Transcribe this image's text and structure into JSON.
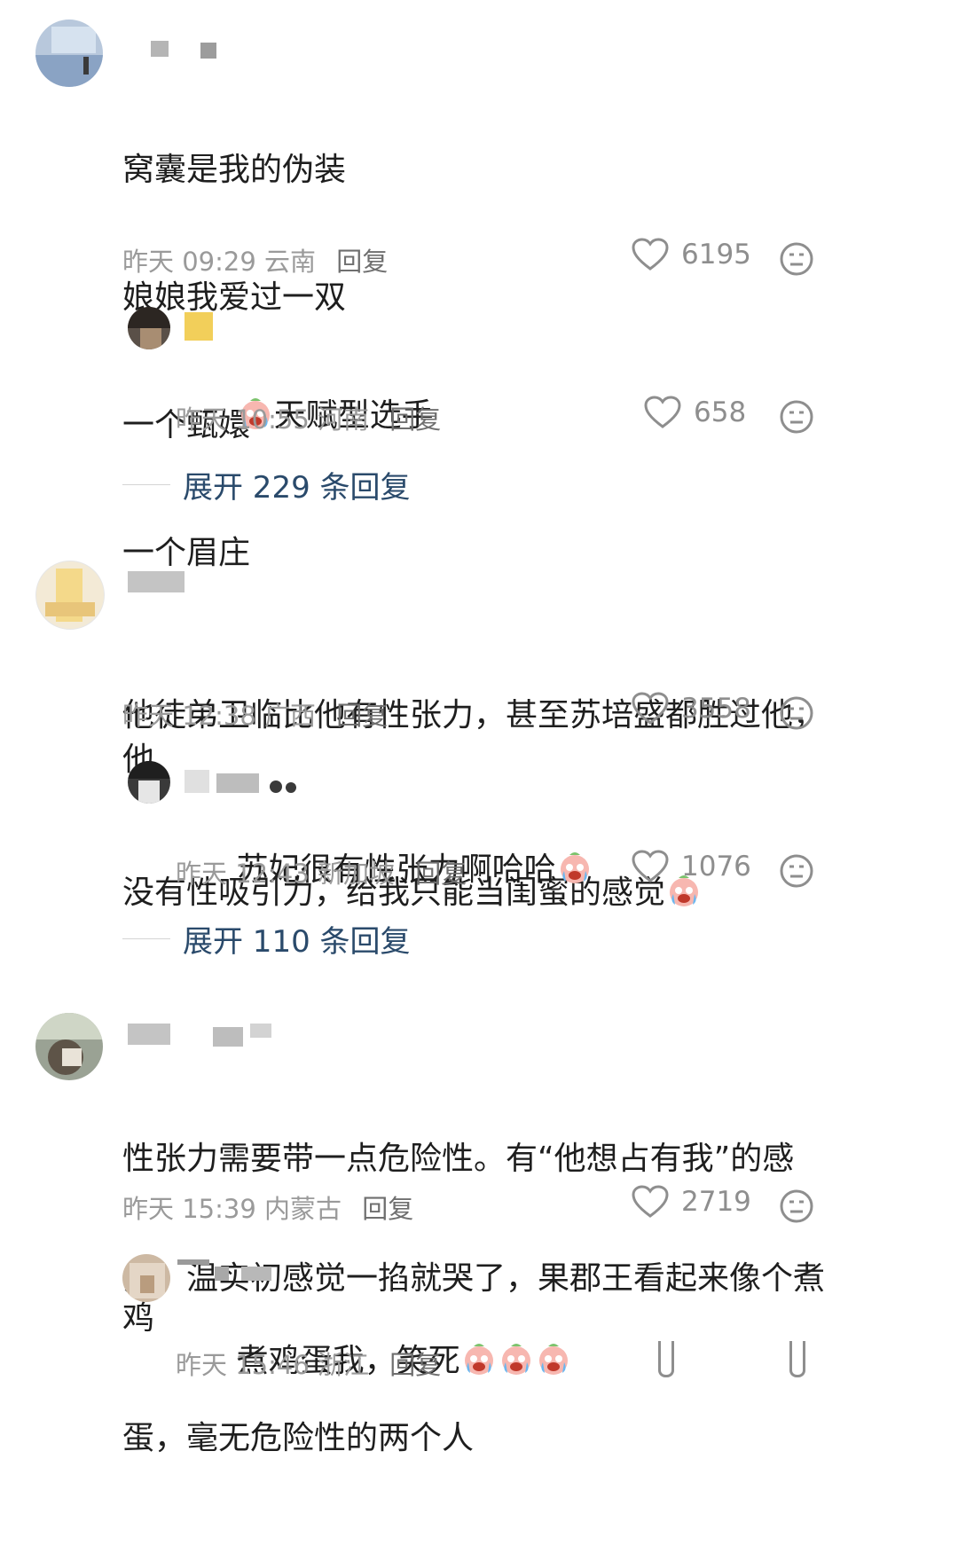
{
  "comments": [
    {
      "id": "c1",
      "lines": [
        "窝囊是我的伪装",
        "娘娘我爱过一双",
        "一个甄嬛",
        "一个眉庄"
      ],
      "time": "昨天 09:29",
      "region": "云南",
      "reply_label": "回复",
      "likes": "6195",
      "replies": [
        {
          "text": "天赋型选手",
          "time": "昨天 10:55",
          "region": "河南",
          "reply_label": "回复",
          "likes": "658"
        }
      ],
      "expand_label": "展开 229 条回复"
    },
    {
      "id": "c2",
      "lines": [
        "他徒弟卫临比他有性张力，甚至苏培盛都胜过他，他",
        "没有性吸引力，给我只能当闺蜜的感觉"
      ],
      "time": "昨天 12:38",
      "region": "广西",
      "reply_label": "回复",
      "likes": "3558",
      "replies": [
        {
          "text": "苏妃很有性张力啊哈哈",
          "time": "昨天 12:43",
          "region": "新加坡",
          "reply_label": "回复",
          "likes": "1076"
        }
      ],
      "expand_label": "展开 110 条回复"
    },
    {
      "id": "c3",
      "lines": [
        "性张力需要带一点危险性。有“他想占有我”的感",
        "觉。温实初感觉一掐就哭了，果郡王看起来像个煮鸡",
        "蛋，毫无危险性的两个人"
      ],
      "time": "昨天 15:39",
      "region": "内蒙古",
      "reply_label": "回复",
      "likes": "2719",
      "replies": [
        {
          "text": "煮鸡蛋我，笑死",
          "time": "昨天 15:46",
          "region": "浙江",
          "reply_label": "回复"
        }
      ]
    }
  ],
  "icons": {
    "like": "heart-outline-icon",
    "dislike": "meh-face-icon",
    "emoji": "crying-laughing-emoji"
  },
  "colors": {
    "expand_link": "#2a4a6b",
    "meta_text": "#9a9a9a",
    "body_text": "#1e1e1e"
  }
}
